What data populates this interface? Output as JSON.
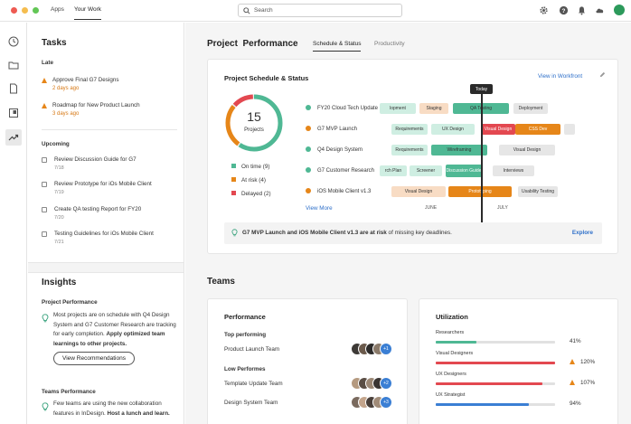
{
  "topbar": {
    "nav": [
      "Apps",
      "Your Work"
    ],
    "search_placeholder": "Search",
    "icons": [
      "gear-icon",
      "help-icon",
      "bell-icon",
      "cloud-icon",
      "avatar"
    ]
  },
  "rail": {
    "icons": [
      "clock-icon",
      "folder-icon",
      "document-icon",
      "review-icon",
      "trend-icon"
    ],
    "active": "trend-icon"
  },
  "tasks": {
    "title": "Tasks",
    "late_label": "Late",
    "late": [
      {
        "title": "Approve Final G7 Designs",
        "due": "2 days ago"
      },
      {
        "title": "Roadmap for New Product Launch",
        "due": "3 days ago"
      }
    ],
    "upcoming_label": "Upcoming",
    "upcoming": [
      {
        "title": "Review Discussion Guide for G7",
        "date": "7/18"
      },
      {
        "title": "Review Prototype for iOs Mobile Client",
        "date": "7/19"
      },
      {
        "title": "Create QA testing Report for FY20",
        "date": "7/20"
      },
      {
        "title": "Testing Guidelines for iOs Mobile Client",
        "date": "7/21"
      }
    ]
  },
  "insights": {
    "title": "Insights",
    "project_perf_label": "Project Performance",
    "project_perf_text": "Most projects are on schedule  with Q4 Design System and G7 Customer Research are tracking for early completion.",
    "project_perf_bold": "Apply optimized team learnings to other projects.",
    "view_recommendations": "View Recommendations",
    "teams_perf_label": "Teams Performance",
    "teams_perf_text": "Few teams are using the new collaboration features in InDesign.",
    "teams_perf_bold": "Host a lunch and learn."
  },
  "main": {
    "title": "Project  Performance",
    "tabs": [
      "Schedule & Status",
      "Productivity"
    ],
    "active_tab": "Schedule & Status",
    "schedule_card": {
      "title": "Project Schedule & Status",
      "view_link": "View in Workfront",
      "donut": {
        "number": "15",
        "label": "Projects",
        "on_time": 9,
        "at_risk": 4,
        "delayed": 2
      },
      "legend": [
        {
          "label": "On time",
          "count": "(9)",
          "color": "#4fb894"
        },
        {
          "label": "At risk",
          "count": "(4)",
          "color": "#e68619"
        },
        {
          "label": "Delayed",
          "count": "(2)",
          "color": "#e34850"
        }
      ],
      "projects": [
        {
          "name": "FY20 Cloud Tech Update",
          "status": "#4fb894"
        },
        {
          "name": "G7 MVP Launch",
          "status": "#e68619"
        },
        {
          "name": "Q4 Design System",
          "status": "#4fb894"
        },
        {
          "name": "G7 Customer Research",
          "status": "#4fb894"
        },
        {
          "name": "iOS Mobile Client v1.3",
          "status": "#e68619"
        }
      ],
      "view_more": "View More",
      "today": "Today",
      "months": [
        "JUNE",
        "JULY"
      ],
      "bars": [
        [
          {
            "label": "lopment",
            "color": "#cfeee2"
          },
          {
            "label": "Staging",
            "color": "#f8dcc4"
          },
          {
            "label": "QA Testing",
            "color": "#4fb894"
          },
          {
            "label": "Deployment",
            "color": "#e6e6e6"
          }
        ],
        [
          {
            "label": "Requirements",
            "color": "#cfeee2"
          },
          {
            "label": "UX Design",
            "color": "#cfeee2"
          },
          {
            "label": "Visual Design",
            "color": "#e34850"
          },
          {
            "label": "CSS Dev",
            "color": "#e68619"
          },
          {
            "label": "",
            "color": "#e6e6e6"
          }
        ],
        [
          {
            "label": "Requirements",
            "color": "#cfeee2"
          },
          {
            "label": "Wireframing",
            "color": "#4fb894"
          },
          {
            "label": "Visual Design",
            "color": "#e6e6e6"
          }
        ],
        [
          {
            "label": "rch Plan",
            "color": "#cfeee2"
          },
          {
            "label": "Screener",
            "color": "#cfeee2"
          },
          {
            "label": "Discussion Guide",
            "color": "#4fb894"
          },
          {
            "label": "Interviews",
            "color": "#e6e6e6"
          }
        ],
        [
          {
            "label": "Visual Design",
            "color": "#f8dcc4"
          },
          {
            "label": "Prototyping",
            "color": "#e68619"
          },
          {
            "label": "Usability Testing",
            "color": "#e6e6e6"
          }
        ]
      ],
      "alert_bold": "G7 MVP Launch and iOS Mobile Client v1.3 are at risk",
      "alert_rest": " of missing key deadlines.",
      "explore": "Explore"
    },
    "teams_title": "Teams",
    "performance": {
      "title": "Performance",
      "top_label": "Top performing",
      "top": [
        {
          "name": "Product Launch Team",
          "more": "+1"
        }
      ],
      "low_label": "Low Performes",
      "low": [
        {
          "name": "Template Update Team",
          "more": "+2"
        },
        {
          "name": "Design System Team",
          "more": "+3"
        }
      ]
    },
    "utilization": {
      "title": "Utilization",
      "items": [
        {
          "label": "Researchers",
          "value": "41%",
          "pct": 41,
          "color": "#4fb894",
          "warn": false
        },
        {
          "label": "Visual Designers",
          "value": "120%",
          "pct": 120,
          "color": "#e34850",
          "warn": true
        },
        {
          "label": "UX Designers",
          "value": "107%",
          "pct": 107,
          "color": "#e34850",
          "warn": true
        },
        {
          "label": "UX Strategist",
          "value": "94%",
          "pct": 94,
          "color": "#3b7fd4",
          "warn": false
        }
      ]
    }
  }
}
